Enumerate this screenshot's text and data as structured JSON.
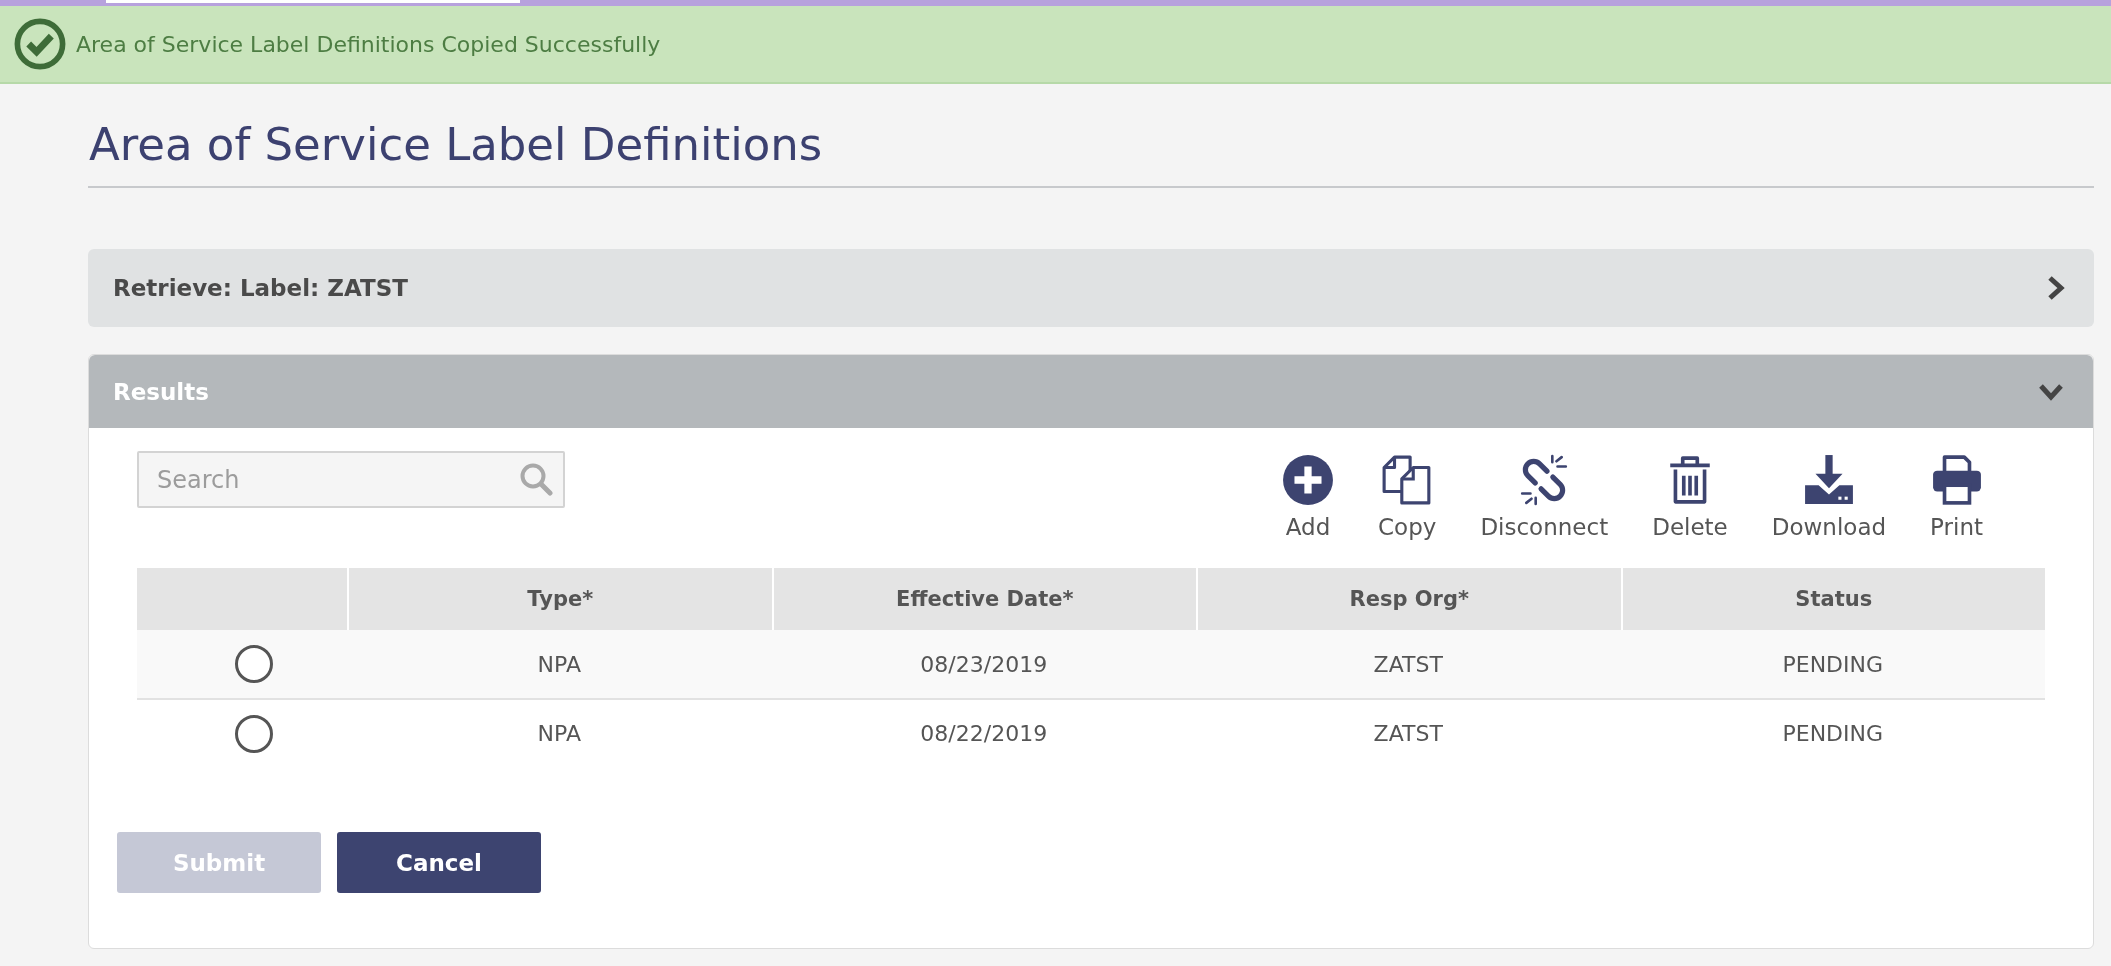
{
  "notification": {
    "kind": "success",
    "message": "Area of Service Label Definitions Copied Successfully"
  },
  "page_title": "Area of Service Label Definitions",
  "retrieve_panel": {
    "title": "Retrieve: Label: ZATST",
    "expanded": false
  },
  "results_panel": {
    "title": "Results",
    "expanded": true,
    "search": {
      "placeholder": "Search"
    },
    "toolbar": [
      {
        "kind": "add",
        "label": "Add"
      },
      {
        "kind": "copy",
        "label": "Copy"
      },
      {
        "kind": "disconnect",
        "label": "Disconnect"
      },
      {
        "kind": "delete",
        "label": "Delete"
      },
      {
        "kind": "download",
        "label": "Download"
      },
      {
        "kind": "print",
        "label": "Print"
      }
    ],
    "table": {
      "columns": [
        "Type*",
        "Effective Date*",
        "Resp Org*",
        "Status"
      ],
      "rows": [
        {
          "selected": false,
          "cells": [
            "NPA",
            "08/23/2019",
            "ZATST",
            "PENDING"
          ]
        },
        {
          "selected": false,
          "cells": [
            "NPA",
            "08/22/2019",
            "ZATST",
            "PENDING"
          ]
        }
      ]
    }
  },
  "buttons": [
    {
      "label": "Submit",
      "disabled": true
    },
    {
      "label": "Cancel",
      "disabled": false
    }
  ]
}
